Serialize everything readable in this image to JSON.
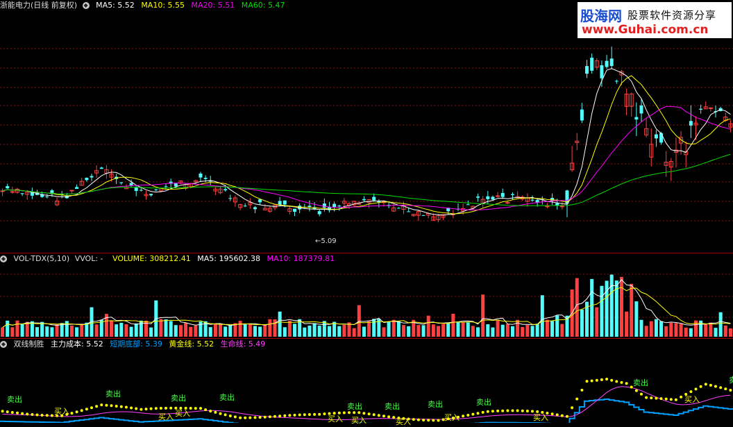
{
  "colors": {
    "bg": "#000000",
    "up": "#ff4040",
    "down": "#54fcfc",
    "ma5": "#ffffff",
    "ma10": "#ffff00",
    "ma20": "#ff00ff",
    "ma60": "#00e000",
    "grid": "#8a1010",
    "divider": "#a00000",
    "vol_label": "#ffff00",
    "short_bottom": "#00a0ff",
    "gold_line": "#ffff00",
    "life_line": "#ff44ff",
    "sell_color": "#44ff44",
    "buy_color": "#ffff00"
  },
  "price_header": {
    "icon": "circle-icon",
    "title": "浙能电力(日线 前复权)",
    "ma5": "MA5: 5.52",
    "ma10": "MA10: 5.55",
    "ma20": "MA20: 5.51",
    "ma60": "MA60: 5.47"
  },
  "low_label": "←5.09",
  "watermark": {
    "name": "股海网",
    "tagline": "股票软件资源分享",
    "url": "www.Guhai.com.cn"
  },
  "volume_header": {
    "icon": "circle-icon",
    "name": "VOL-TDX(5,10)",
    "vvol": "VVOL: -",
    "volume": "VOLUME: 308212.41",
    "ma5": "MA5: 195602.38",
    "ma10": "MA10: 187379.81"
  },
  "indicator_header": {
    "icon": "circle-icon",
    "name": "双线制胜",
    "main_cost": "主力成本: 5.52",
    "short_bottom": "短期底部: 5.39",
    "gold_line": "黄金线: 5.52",
    "life_line": "生命线: 5.49"
  },
  "signals": {
    "sell": "卖出",
    "buy": "买入"
  }
}
